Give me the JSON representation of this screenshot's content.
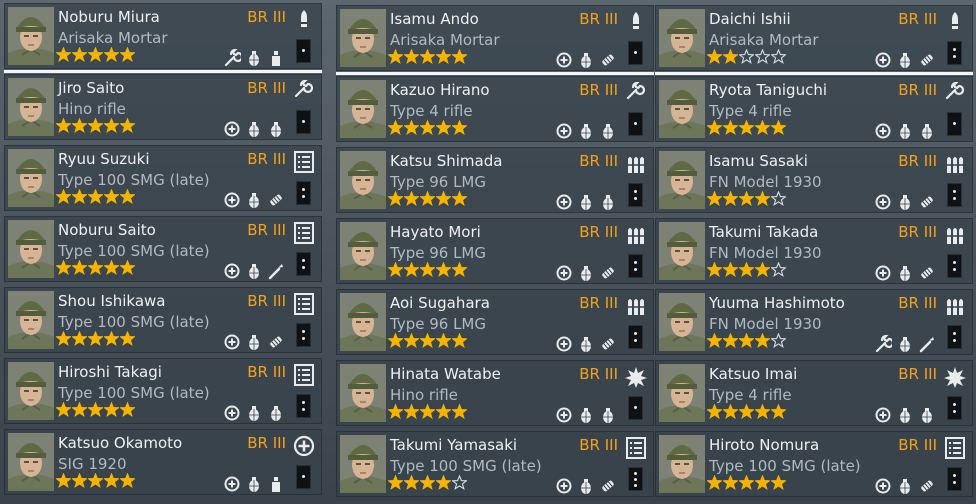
{
  "columns": [
    {
      "selected_index": 0,
      "soldiers": [
        {
          "name": "Noburu Miura",
          "weapon": "Arisaka Mortar",
          "br": "BR III",
          "stars": 5,
          "class_icon": "mortar-shell-icon",
          "perks": [
            "wrench-icon",
            "grenade-icon",
            "flask-icon"
          ],
          "rank_dots": 1
        },
        {
          "name": "Jiro Saito",
          "weapon": "Hino rifle",
          "br": "BR III",
          "stars": 5,
          "class_icon": "wrench-icon",
          "perks": [
            "medkit-icon",
            "grenade-icon",
            "grenade-icon"
          ],
          "rank_dots": 1
        },
        {
          "name": "Ryuu Suzuki",
          "weapon": "Type 100 SMG (late)",
          "br": "BR III",
          "stars": 5,
          "class_icon": "list-icon",
          "perks": [
            "medkit-icon",
            "grenade-icon",
            "ammo-icon"
          ],
          "rank_dots": 2
        },
        {
          "name": "Noburu Saito",
          "weapon": "Type 100 SMG (late)",
          "br": "BR III",
          "stars": 5,
          "class_icon": "list-icon",
          "perks": [
            "medkit-icon",
            "grenade-icon",
            "torch-icon"
          ],
          "rank_dots": 2
        },
        {
          "name": "Shou Ishikawa",
          "weapon": "Type 100 SMG (late)",
          "br": "BR III",
          "stars": 5,
          "class_icon": "list-icon",
          "perks": [
            "medkit-icon",
            "grenade-icon",
            "ammo-icon"
          ],
          "rank_dots": 2
        },
        {
          "name": "Hiroshi Takagi",
          "weapon": "Type 100 SMG (late)",
          "br": "BR III",
          "stars": 5,
          "class_icon": "list-icon",
          "perks": [
            "medkit-icon",
            "grenade-icon",
            "grenade-icon"
          ],
          "rank_dots": 2
        },
        {
          "name": "Katsuo Okamoto",
          "weapon": "SIG 1920",
          "br": "BR III",
          "stars": 5,
          "class_icon": "medic-cross-icon",
          "perks": [
            "medkit-icon",
            "grenade-icon",
            "flask-icon"
          ],
          "rank_dots": 1
        }
      ]
    },
    {
      "selected_index": 0,
      "soldiers": [
        {
          "name": "Isamu Ando",
          "weapon": "Arisaka Mortar",
          "br": "BR III",
          "stars": 5,
          "class_icon": "mortar-shell-icon",
          "perks": [
            "medkit-icon",
            "grenade-icon",
            "ammo-icon"
          ],
          "rank_dots": 1
        },
        {
          "name": "Kazuo Hirano",
          "weapon": "Type 4 rifle",
          "br": "BR III",
          "stars": 5,
          "class_icon": "wrench-icon",
          "perks": [
            "medkit-icon",
            "grenade-icon",
            "grenade-icon"
          ],
          "rank_dots": 1
        },
        {
          "name": "Katsu Shimada",
          "weapon": "Type 96 LMG",
          "br": "BR III",
          "stars": 5,
          "class_icon": "ammo-belt-icon",
          "perks": [
            "medkit-icon",
            "grenade-icon",
            "grenade-icon"
          ],
          "rank_dots": 2
        },
        {
          "name": "Hayato Mori",
          "weapon": "Type 96 LMG",
          "br": "BR III",
          "stars": 5,
          "class_icon": "ammo-belt-icon",
          "perks": [
            "medkit-icon",
            "grenade-icon",
            "ammo-icon"
          ],
          "rank_dots": 2
        },
        {
          "name": "Aoi Sugahara",
          "weapon": "Type 96 LMG",
          "br": "BR III",
          "stars": 5,
          "class_icon": "ammo-belt-icon",
          "perks": [
            "medkit-icon",
            "grenade-icon",
            "ammo-icon"
          ],
          "rank_dots": 2
        },
        {
          "name": "Hinata Watabe",
          "weapon": "Hino rifle",
          "br": "BR III",
          "stars": 5,
          "class_icon": "explosion-icon",
          "perks": [
            "medkit-icon",
            "grenade-icon",
            "grenade-icon"
          ],
          "rank_dots": 1
        },
        {
          "name": "Takumi Yamasaki",
          "weapon": "Type 100 SMG (late)",
          "br": "BR III",
          "stars": 4,
          "class_icon": "list-icon",
          "perks": [
            "medkit-icon",
            "grenade-icon",
            "ammo-icon"
          ],
          "rank_dots": 3
        }
      ]
    },
    {
      "selected_index": 0,
      "soldiers": [
        {
          "name": "Daichi Ishii",
          "weapon": "Arisaka Mortar",
          "br": "BR III",
          "stars": 2,
          "class_icon": "mortar-shell-icon",
          "perks": [
            "medkit-icon",
            "grenade-icon",
            "ammo-icon"
          ],
          "rank_dots": 2
        },
        {
          "name": "Ryota Taniguchi",
          "weapon": "Type 4 rifle",
          "br": "BR III",
          "stars": 5,
          "class_icon": "wrench-icon",
          "perks": [
            "medkit-icon",
            "grenade-icon",
            "grenade-icon"
          ],
          "rank_dots": 1
        },
        {
          "name": "Isamu Sasaki",
          "weapon": "FN Model 1930",
          "br": "BR III",
          "stars": 4,
          "class_icon": "ammo-belt-icon",
          "perks": [
            "medkit-icon",
            "grenade-icon",
            "ammo-icon"
          ],
          "rank_dots": 2
        },
        {
          "name": "Takumi Takada",
          "weapon": "FN Model 1930",
          "br": "BR III",
          "stars": 4,
          "class_icon": "ammo-belt-icon",
          "perks": [
            "medkit-icon",
            "grenade-icon",
            "ammo-icon"
          ],
          "rank_dots": 2
        },
        {
          "name": "Yuuma Hashimoto",
          "weapon": "FN Model 1930",
          "br": "BR III",
          "stars": 4,
          "class_icon": "ammo-belt-icon",
          "perks": [
            "wrench-icon",
            "grenade-icon",
            "torch-icon"
          ],
          "rank_dots": 2
        },
        {
          "name": "Katsuo Imai",
          "weapon": "Type 4 rifle",
          "br": "BR III",
          "stars": 5,
          "class_icon": "explosion-icon",
          "perks": [
            "medkit-icon",
            "grenade-icon",
            "grenade-icon"
          ],
          "rank_dots": 2
        },
        {
          "name": "Hiroto Nomura",
          "weapon": "Type 100 SMG (late)",
          "br": "BR III",
          "stars": 5,
          "class_icon": "list-icon",
          "perks": [
            "medkit-icon",
            "grenade-icon",
            "ammo-icon"
          ],
          "rank_dots": 2
        }
      ]
    }
  ],
  "colors": {
    "br_text": "#f2a21b",
    "star_filled": "#f5b400",
    "star_empty": "#d8dde1",
    "name_text": "#eef1f3",
    "weapon_text": "#b2bac1",
    "selection_bar": "#f2f4f5"
  }
}
